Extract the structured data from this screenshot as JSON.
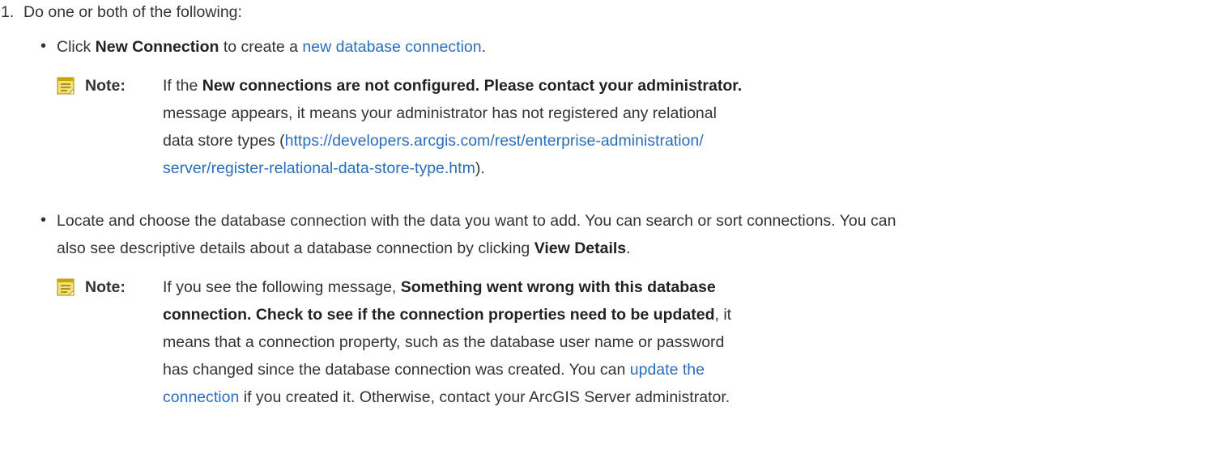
{
  "step": {
    "number": "1.",
    "text": "Do one or both of the following:"
  },
  "bullet1": {
    "pre": "Click ",
    "bold": "New Connection",
    "mid": " to create a ",
    "link": "new database connection",
    "post": "."
  },
  "note1": {
    "label": "Note:",
    "pre": "If the ",
    "bold": "New connections are not configured. Please contact your administrator.",
    "line2": "message appears, it means your administrator has not registered any relational",
    "line3_pre": "data store types (",
    "link_line1": "https://developers.arcgis.com/rest/enterprise-administration/",
    "link_line2": "server/register-relational-data-store-type.htm",
    "link_post": ")."
  },
  "bullet2": {
    "line1": "Locate and choose the database connection with the data you want to add. You can search or sort connections. You can",
    "line2_pre": "also see descriptive details about a database connection by clicking ",
    "bold": "View Details",
    "post": "."
  },
  "note2": {
    "label": "Note:",
    "pre": "If you see the following message, ",
    "bold_line1": "Something went wrong with this database",
    "bold_line2": "connection. Check to see if the connection properties need to be updated",
    "line2_post": ", it",
    "line3": "means that a connection property, such as the database user name or password",
    "line4_pre": "has changed since the database connection was created. You can ",
    "link_line1": "update the",
    "link_line2": "connection",
    "line5_post": " if you created it. Otherwise, contact your ArcGIS Server administrator."
  },
  "colors": {
    "link": "#2a6ebb",
    "text": "#333333",
    "note_icon": "#c8b400"
  }
}
